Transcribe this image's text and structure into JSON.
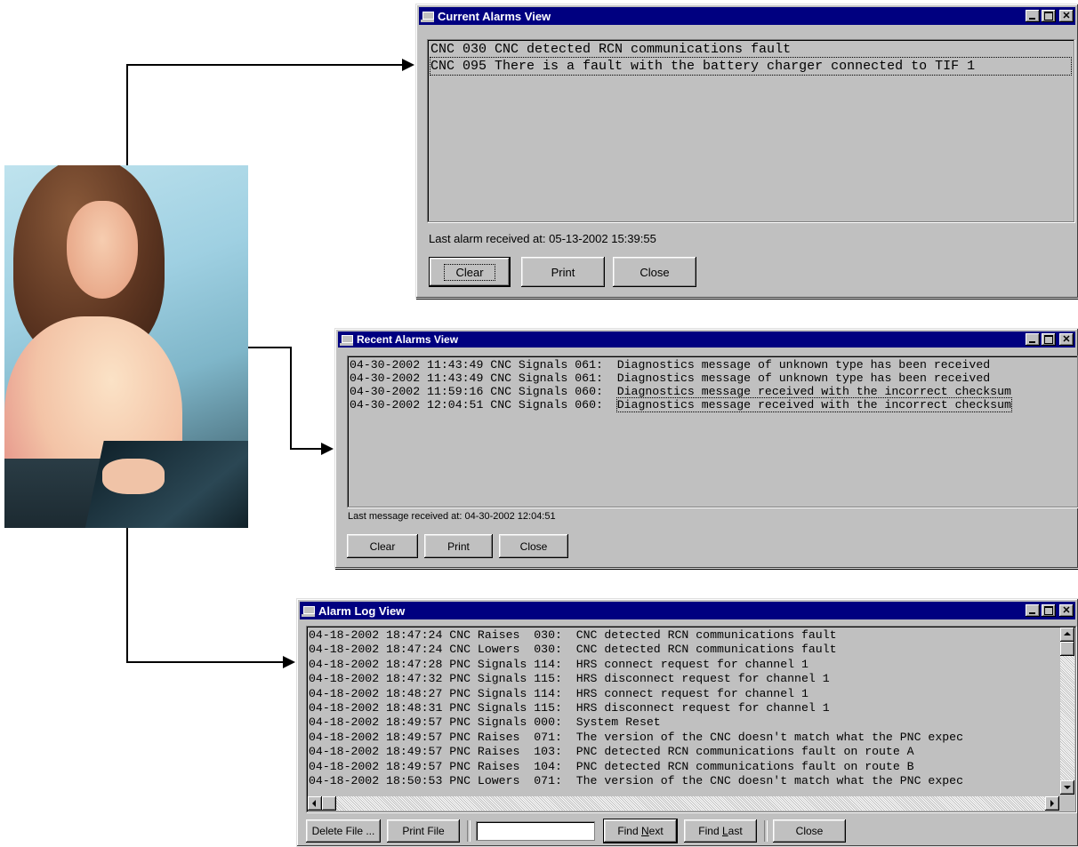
{
  "current_alarms": {
    "title": "Current Alarms View",
    "rows": [
      "CNC 030 CNC detected RCN communications fault",
      "CNC 095 There is a fault with the battery charger connected to TIF 1"
    ],
    "status": "Last alarm received at: 05-13-2002 15:39:55",
    "buttons": {
      "clear": "Clear",
      "print": "Print",
      "close": "Close"
    }
  },
  "recent_alarms": {
    "title": "Recent Alarms View",
    "rows": [
      "04-30-2002 11:43:49 CNC Signals 061:  Diagnostics message of unknown type has been received",
      "04-30-2002 11:43:49 CNC Signals 061:  Diagnostics message of unknown type has been received",
      "04-30-2002 11:59:16 CNC Signals 060:  Diagnostics message received with the incorrect checksum",
      "04-30-2002 12:04:51 CNC Signals 060:  "
    ],
    "last_row_selected": "Diagnostics message received with the incorrect checksum",
    "status": "Last message received at: 04-30-2002 12:04:51",
    "buttons": {
      "clear": "Clear",
      "print": "Print",
      "close": "Close"
    }
  },
  "alarm_log": {
    "title": "Alarm Log View",
    "rows": [
      "04-18-2002 18:47:24 CNC Raises  030:  CNC detected RCN communications fault",
      "04-18-2002 18:47:24 CNC Lowers  030:  CNC detected RCN communications fault",
      "04-18-2002 18:47:28 PNC Signals 114:  HRS connect request for channel 1",
      "04-18-2002 18:47:32 PNC Signals 115:  HRS disconnect request for channel 1",
      "04-18-2002 18:48:27 PNC Signals 114:  HRS connect request for channel 1",
      "04-18-2002 18:48:31 PNC Signals 115:  HRS disconnect request for channel 1",
      "04-18-2002 18:49:57 PNC Signals 000:  System Reset",
      "04-18-2002 18:49:57 PNC Raises  071:  The version of the CNC doesn't match what the PNC expec",
      "04-18-2002 18:49:57 PNC Raises  103:  PNC detected RCN communications fault on route A",
      "04-18-2002 18:49:57 PNC Raises  104:  PNC detected RCN communications fault on route B",
      "04-18-2002 18:50:53 PNC Lowers  071:  The version of the CNC doesn't match what the PNC expec"
    ],
    "buttons": {
      "delete_file": "Delete File ...",
      "print_file": "Print File",
      "find_next_pre": "Find ",
      "find_next_ul": "N",
      "find_next_post": "ext",
      "find_last_pre": "Find ",
      "find_last_ul": "L",
      "find_last_post": "ast",
      "close": "Close"
    },
    "find_value": ""
  },
  "icons": {
    "window_icon": "computer-icon",
    "minimize": "minimize-icon",
    "maximize": "maximize-icon",
    "close": "close-icon"
  },
  "colors": {
    "titlebar": "#000080",
    "window": "#c0c0c0"
  }
}
